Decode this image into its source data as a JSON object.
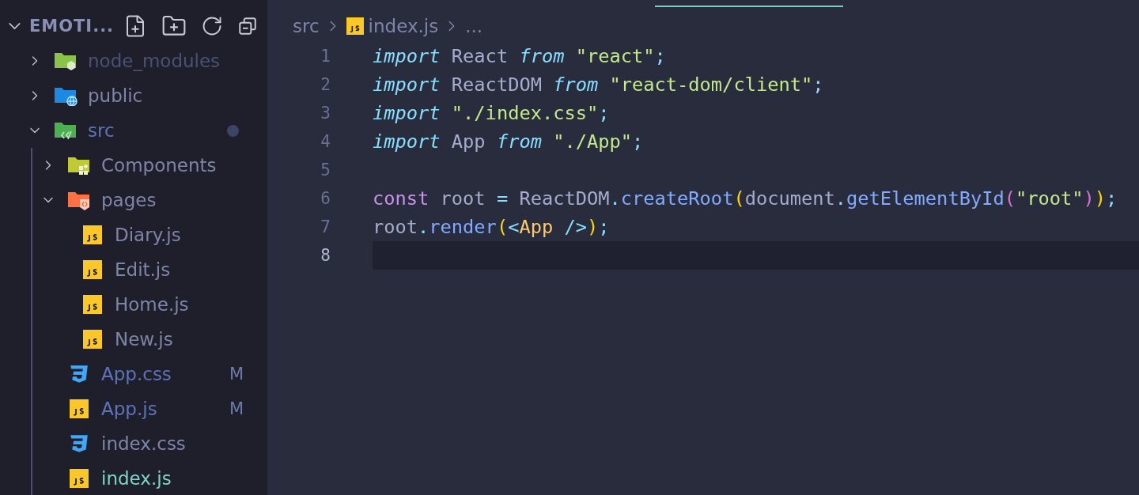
{
  "explorer": {
    "title": "EMOTI...",
    "tree": [
      {
        "name": "node_modules",
        "kind": "node-folder",
        "expanded": false,
        "dimmed": true,
        "modified": false,
        "selected": false
      },
      {
        "name": "public",
        "kind": "public-folder",
        "expanded": false,
        "dimmed": false,
        "modified": false,
        "selected": false
      },
      {
        "name": "src",
        "kind": "src-folder",
        "expanded": true,
        "dimmed": false,
        "modified": true,
        "selected": false,
        "children": [
          {
            "name": "Components",
            "kind": "components-folder",
            "expanded": false,
            "dimmed": false,
            "modified": false,
            "selected": false
          },
          {
            "name": "pages",
            "kind": "pages-folder",
            "expanded": true,
            "dimmed": false,
            "modified": false,
            "selected": false,
            "children": [
              {
                "name": "Diary.js",
                "kind": "js",
                "dimmed": false,
                "modified": false,
                "selected": false
              },
              {
                "name": "Edit.js",
                "kind": "js",
                "dimmed": false,
                "modified": false,
                "selected": false
              },
              {
                "name": "Home.js",
                "kind": "js",
                "dimmed": false,
                "modified": false,
                "selected": false
              },
              {
                "name": "New.js",
                "kind": "js",
                "dimmed": false,
                "modified": false,
                "selected": false
              }
            ]
          },
          {
            "name": "App.css",
            "kind": "css",
            "dimmed": false,
            "modified": true,
            "badge": "M",
            "selected": false
          },
          {
            "name": "App.js",
            "kind": "js",
            "dimmed": false,
            "modified": true,
            "badge": "M",
            "selected": false
          },
          {
            "name": "index.css",
            "kind": "css",
            "dimmed": false,
            "modified": false,
            "selected": false
          },
          {
            "name": "index.js",
            "kind": "js",
            "dimmed": false,
            "modified": false,
            "selected": true
          }
        ]
      }
    ]
  },
  "breadcrumb": [
    {
      "text": "src",
      "kind": "folder"
    },
    {
      "text": "index.js",
      "kind": "js"
    },
    {
      "text": "...",
      "kind": "more"
    }
  ],
  "code": [
    {
      "number": "1",
      "current": false,
      "tokens": [
        {
          "text": "import",
          "kind": "keyword"
        },
        {
          "text": " React ",
          "kind": "ident"
        },
        {
          "text": "from",
          "kind": "keyword"
        },
        {
          "text": " \"react\"",
          "kind": "string"
        },
        {
          "text": ";",
          "kind": "punct"
        }
      ]
    },
    {
      "number": "2",
      "current": false,
      "tokens": [
        {
          "text": "import",
          "kind": "keyword"
        },
        {
          "text": " ReactDOM ",
          "kind": "ident"
        },
        {
          "text": "from",
          "kind": "keyword"
        },
        {
          "text": " \"react-dom/client\"",
          "kind": "string"
        },
        {
          "text": ";",
          "kind": "punct"
        }
      ]
    },
    {
      "number": "3",
      "current": false,
      "tokens": [
        {
          "text": "import",
          "kind": "keyword"
        },
        {
          "text": " \"./index.css\"",
          "kind": "string"
        },
        {
          "text": ";",
          "kind": "punct"
        }
      ]
    },
    {
      "number": "4",
      "current": false,
      "tokens": [
        {
          "text": "import",
          "kind": "keyword"
        },
        {
          "text": " App ",
          "kind": "ident"
        },
        {
          "text": "from",
          "kind": "keyword"
        },
        {
          "text": " \"./App\"",
          "kind": "string"
        },
        {
          "text": ";",
          "kind": "punct"
        }
      ]
    },
    {
      "number": "5",
      "current": false
    },
    {
      "number": "6",
      "current": false,
      "tokens": [
        {
          "text": "const",
          "kind": "storage"
        },
        {
          "text": " root ",
          "kind": "ident"
        },
        {
          "text": "=",
          "kind": "punct"
        },
        {
          "text": " ReactDOM",
          "kind": "ident"
        },
        {
          "text": ".",
          "kind": "punct"
        },
        {
          "text": "createRoot",
          "kind": "func"
        },
        {
          "text": "(",
          "kind": "paren1"
        },
        {
          "text": "document",
          "kind": "ident"
        },
        {
          "text": ".",
          "kind": "punct"
        },
        {
          "text": "getElementById",
          "kind": "func"
        },
        {
          "text": "(",
          "kind": "paren2"
        },
        {
          "text": "\"root\"",
          "kind": "string"
        },
        {
          "text": ")",
          "kind": "paren2"
        },
        {
          "text": ")",
          "kind": "paren1"
        },
        {
          "text": ";",
          "kind": "punct"
        }
      ]
    },
    {
      "number": "7",
      "current": false,
      "tokens": [
        {
          "text": "root",
          "kind": "ident"
        },
        {
          "text": ".",
          "kind": "punct"
        },
        {
          "text": "render",
          "kind": "func"
        },
        {
          "text": "(",
          "kind": "paren1"
        },
        {
          "text": "<",
          "kind": "punct"
        },
        {
          "text": "App",
          "kind": "tag"
        },
        {
          "text": " />",
          "kind": "punct"
        },
        {
          "text": ")",
          "kind": "paren1"
        },
        {
          "text": ";",
          "kind": "punct"
        }
      ]
    },
    {
      "number": "8",
      "current": true
    }
  ]
}
